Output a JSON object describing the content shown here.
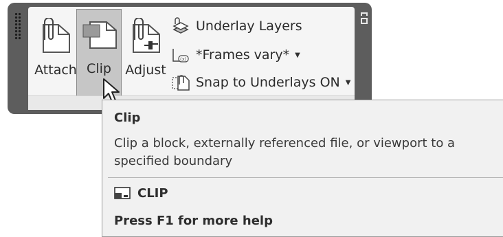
{
  "ribbon": {
    "buttons": {
      "attach_label": "Attach",
      "clip_label": "Clip",
      "adjust_label": "Adjust"
    },
    "small_buttons": {
      "underlay_layers": "Underlay Layers",
      "frames": "*Frames vary*",
      "snap": "Snap to Underlays ON"
    }
  },
  "tooltip": {
    "title": "Clip",
    "description": "Clip a block, externally referenced file, or viewport to a specified boundary",
    "command": "CLIP",
    "help": "Press F1 for more help"
  },
  "colors": {
    "ribbon_frame": "#5d5d5d",
    "panel_bg": "#f5f5f5",
    "clip_highlight": "#c6c6c6",
    "tooltip_bg": "#f1f1f1"
  },
  "icons": [
    "grip-icon",
    "paperclip-document-icon",
    "clip-icon",
    "adjust-icon",
    "underlay-layers-icon",
    "frames-icon",
    "snap-underlay-icon",
    "dropdown-caret-icon",
    "mouse-cursor-icon",
    "clip-command-icon"
  ]
}
